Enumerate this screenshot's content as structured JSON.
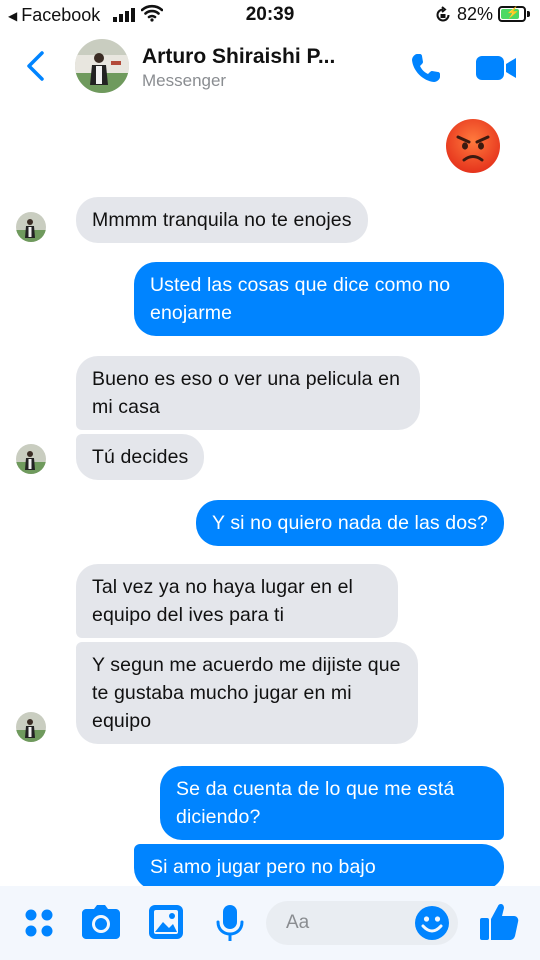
{
  "status_bar": {
    "back_app": "Facebook",
    "time": "20:39",
    "battery": "82%",
    "battery_level": 0.82
  },
  "header": {
    "contact_name": "Arturo Shiraishi P...",
    "subtitle": "Messenger"
  },
  "messages": [
    {
      "side": "out",
      "type": "emoji",
      "icon": "angry-face-emoji"
    },
    {
      "side": "in",
      "text": "Mmmm tranquila no te enojes",
      "avatar": true
    },
    {
      "side": "out",
      "text": "Usted las cosas que dice como no enojarme"
    },
    {
      "side": "in",
      "text": "Bueno es eso o ver una pelicula en mi casa",
      "avatar": false
    },
    {
      "side": "in",
      "text": "Tú decides",
      "avatar": true
    },
    {
      "side": "out",
      "text": "Y si no quiero nada de las dos?"
    },
    {
      "side": "in",
      "text": "Tal vez ya no haya lugar en el equipo del ives para ti",
      "avatar": false
    },
    {
      "side": "in",
      "text": "Y segun me acuerdo me dijiste que te gustaba mucho jugar en mi equipo",
      "avatar": true
    },
    {
      "side": "out",
      "text": "Se da cuenta de lo que me está diciendo?"
    },
    {
      "side": "out",
      "text": "Si amo jugar pero no bajo"
    }
  ],
  "composer": {
    "placeholder": "Aa",
    "icons": [
      "apps-icon",
      "camera-icon",
      "gallery-icon",
      "microphone-icon",
      "emoji-icon",
      "like-icon"
    ]
  },
  "colors": {
    "accent": "#0084ff",
    "incoming_bubble": "#e4e6eb",
    "composer_bg": "#f3f7fd"
  }
}
